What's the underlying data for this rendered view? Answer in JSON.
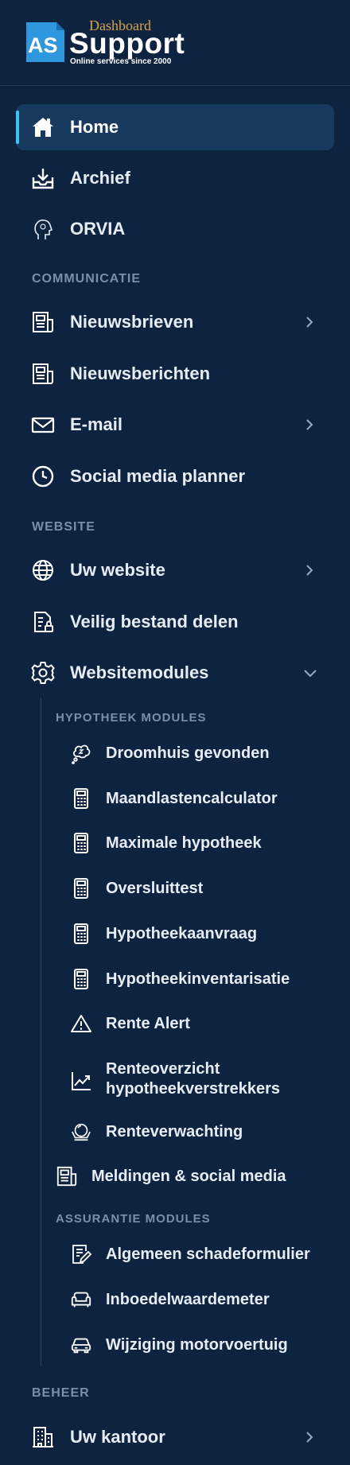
{
  "brand": {
    "logo_initials": "AS",
    "dashboard": "Dashboard",
    "name": "Support",
    "tagline": "Online services since 2000"
  },
  "colors": {
    "background": "#0d2340",
    "active_item": "#183a5e",
    "active_bar": "#3ec2f0",
    "section_text": "#7d8fa7",
    "logo_blue": "#2f97dd",
    "logo_gold": "#d8a24a"
  },
  "nav": {
    "home": "Home",
    "archief": "Archief",
    "orvia": "ORVIA"
  },
  "sections": {
    "communicatie": "COMMUNICATIE",
    "website": "WEBSITE",
    "beheer": "BEHEER"
  },
  "communicatie": {
    "nieuwsbrieven": "Nieuwsbrieven",
    "nieuwsberichten": "Nieuwsberichten",
    "email": "E-mail",
    "social": "Social media planner"
  },
  "website": {
    "uw_website": "Uw website",
    "veilig": "Veilig bestand delen",
    "websitemodules": "Websitemodules"
  },
  "modules": {
    "hypotheek_header": "HYPOTHEEK MODULES",
    "hypotheek": [
      "Droomhuis gevonden",
      "Maandlastencalculator",
      "Maximale hypotheek",
      "Oversluittest",
      "Hypotheekaanvraag",
      "Hypotheekinventarisatie",
      "Rente Alert",
      "Renteoverzicht",
      "hypotheekverstrekkers",
      "Renteverwachting"
    ],
    "meldingen": "Meldingen & social media",
    "assurantie_header": "ASSURANTIE MODULES",
    "assurantie": [
      "Algemeen schadeformulier",
      "Inboedelwaardemeter",
      "Wijziging motorvoertuig"
    ]
  },
  "beheer": {
    "uw_kantoor": "Uw kantoor"
  },
  "icons": {
    "home": "home-icon",
    "archief": "inbox-download-icon",
    "orvia": "head-profile-icon",
    "newsletter": "newspaper-icon",
    "email": "envelope-icon",
    "social": "clock-icon",
    "website": "globe-icon",
    "secure_file": "secure-file-icon",
    "modules": "gear-icon",
    "dream": "thought-bubble-icon",
    "calculator": "calculator-icon",
    "alert": "warning-icon",
    "chart": "trend-chart-icon",
    "forecast": "crystal-ball-icon",
    "form": "form-edit-icon",
    "sofa": "sofa-icon",
    "car": "car-icon",
    "office": "building-icon",
    "chevron_right": "chevron-right-icon",
    "chevron_down": "chevron-down-icon"
  }
}
